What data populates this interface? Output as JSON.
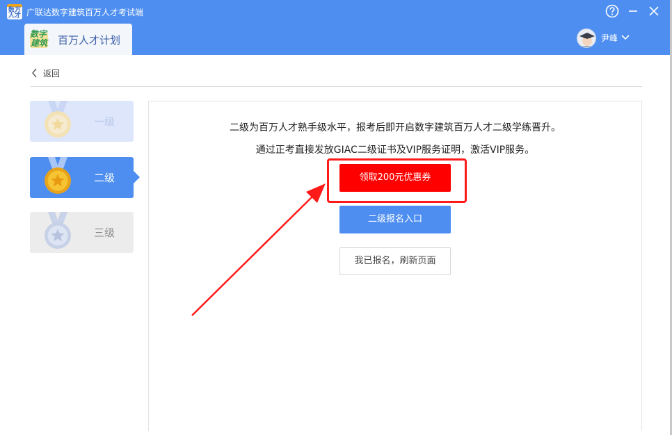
{
  "window": {
    "app_title": "广联达数字建筑百万人才考试端",
    "logo_text_top": "数万",
    "logo_text_bottom": "人才"
  },
  "tab": {
    "label": "百万人才计划",
    "logo_line1": "数字",
    "logo_line2": "建筑"
  },
  "user": {
    "name": "尹峰"
  },
  "nav": {
    "back_label": "返回"
  },
  "levels": [
    {
      "label": "一级",
      "state": "disabled"
    },
    {
      "label": "二级",
      "state": "selected"
    },
    {
      "label": "三级",
      "state": "inactive"
    }
  ],
  "content": {
    "description_line1": "二级为百万人才熟手级水平，报考后即开启数字建筑百万人才二级学练晋升。",
    "description_line2": "通过正考直接发放GIAC二级证书及VIP服务证明，激活VIP服务。",
    "coupon_button": "领取200元优惠券",
    "register_button": "二级报名入口",
    "refresh_button": "我已报名，刷新页面"
  },
  "colors": {
    "titlebar": "#4d8ef0",
    "primary": "#4d8ef0",
    "coupon": "#ff0000",
    "annotation": "#ff1a1a"
  },
  "icons": [
    "help-icon",
    "minimize-icon",
    "close-icon",
    "chevron-down-icon",
    "back-arrow-icon",
    "medal-icon",
    "annotation-arrow"
  ]
}
